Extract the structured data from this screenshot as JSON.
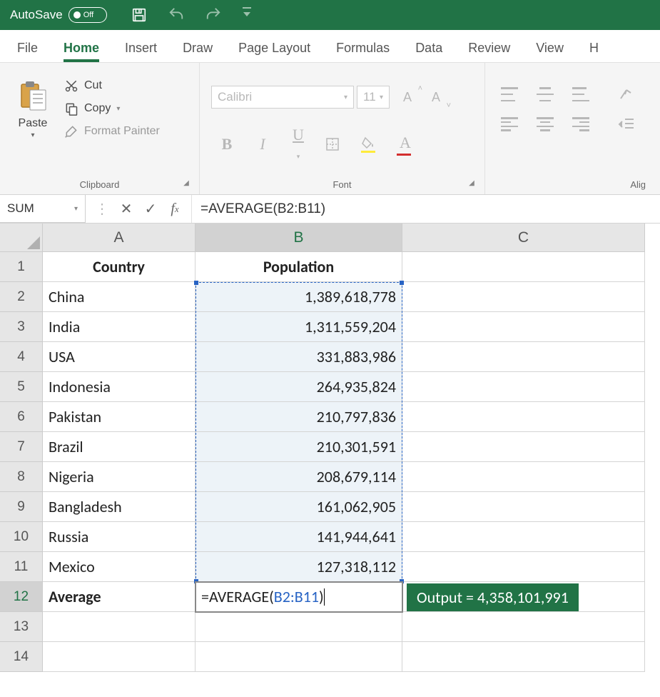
{
  "titlebar": {
    "autosave_label": "AutoSave",
    "autosave_state": "Off"
  },
  "tabs": [
    "File",
    "Home",
    "Insert",
    "Draw",
    "Page Layout",
    "Formulas",
    "Data",
    "Review",
    "View",
    "H"
  ],
  "active_tab": "Home",
  "ribbon": {
    "clipboard": {
      "paste": "Paste",
      "cut": "Cut",
      "copy": "Copy",
      "format_painter": "Format Painter",
      "group_label": "Clipboard"
    },
    "font": {
      "name": "Calibri",
      "size": "11",
      "group_label": "Font"
    },
    "alignment": {
      "group_label": "Alig"
    }
  },
  "formula_bar": {
    "name_box": "SUM",
    "formula": "=AVERAGE(B2:B11)"
  },
  "grid": {
    "columns": [
      "A",
      "B",
      "C"
    ],
    "headers": {
      "A": "Country",
      "B": "Population"
    },
    "rows": [
      {
        "country": "China",
        "population": "1,389,618,778"
      },
      {
        "country": "India",
        "population": "1,311,559,204"
      },
      {
        "country": "USA",
        "population": "331,883,986"
      },
      {
        "country": "Indonesia",
        "population": "264,935,824"
      },
      {
        "country": "Pakistan",
        "population": "210,797,836"
      },
      {
        "country": "Brazil",
        "population": "210,301,591"
      },
      {
        "country": "Nigeria",
        "population": "208,679,114"
      },
      {
        "country": "Bangladesh",
        "population": "161,062,905"
      },
      {
        "country": "Russia",
        "population": "141,944,641"
      },
      {
        "country": "Mexico",
        "population": "127,318,112"
      }
    ],
    "summary_label": "Average",
    "editing_formula_prefix": "=AVERAGE(",
    "editing_formula_ref": "B2:B11",
    "editing_formula_suffix": ")",
    "output_text": "Output = 4,358,101,991"
  }
}
